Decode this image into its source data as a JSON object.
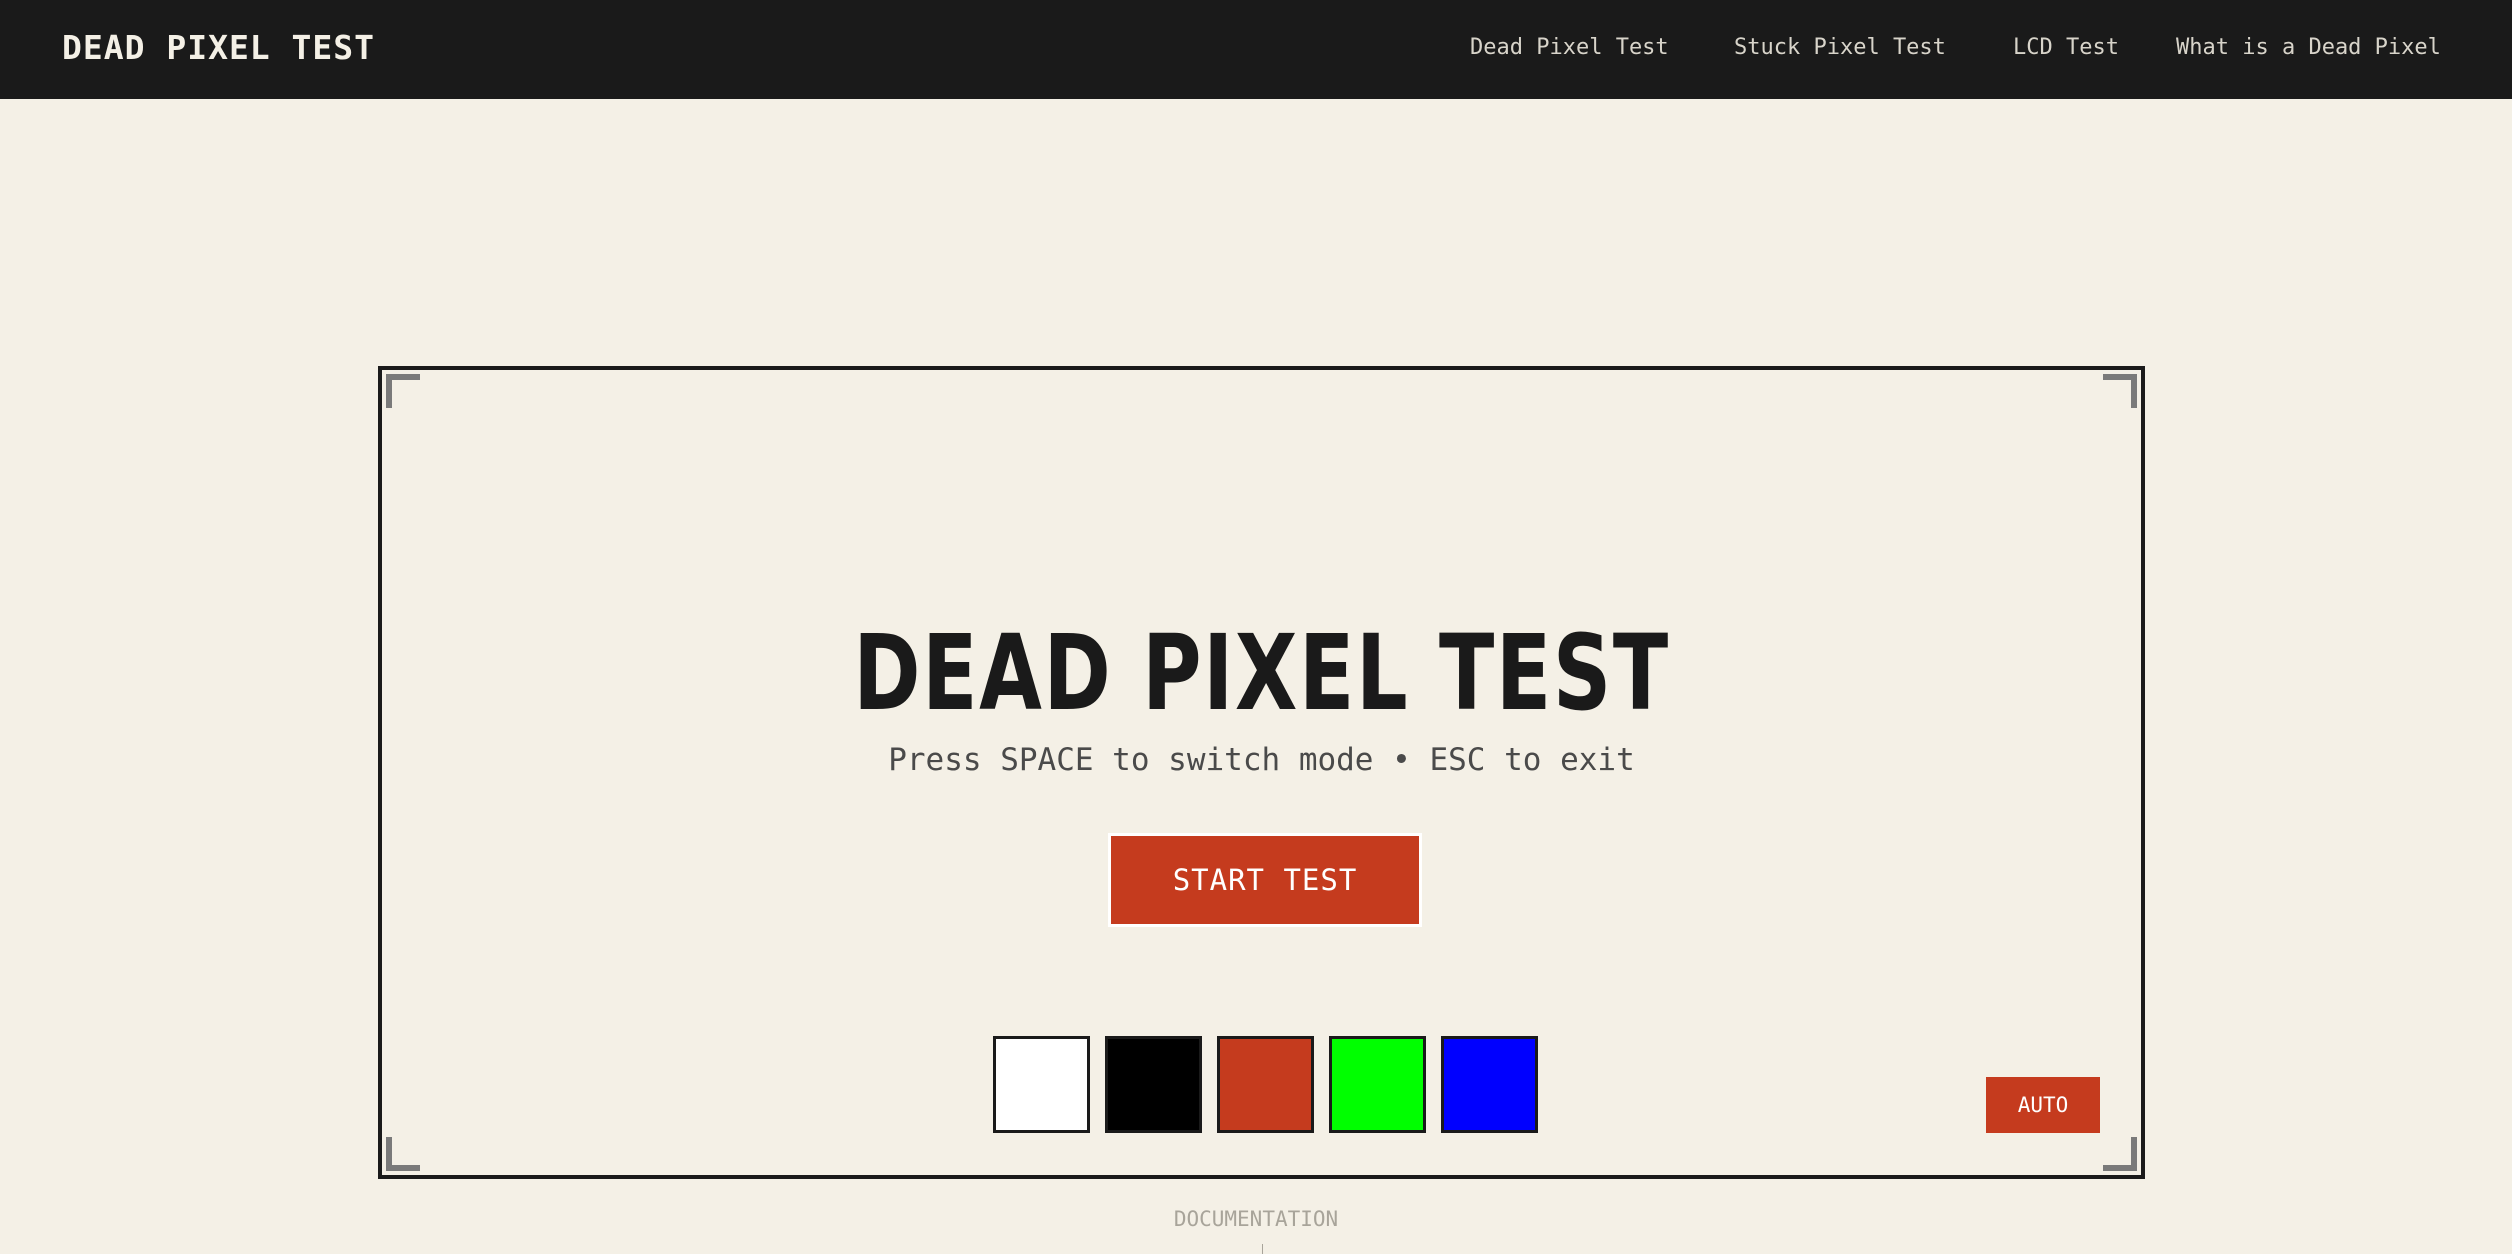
{
  "header": {
    "brand": "DEAD PIXEL TEST",
    "nav": [
      {
        "label": "Dead Pixel Test"
      },
      {
        "label": "Stuck Pixel Test"
      },
      {
        "label": "LCD Test"
      },
      {
        "label": "What is a Dead Pixel"
      }
    ]
  },
  "hero": {
    "title": "DEAD PIXEL TEST",
    "subtitle": "Press SPACE to switch mode • ESC to exit",
    "start_label": "START TEST",
    "auto_label": "AUTO"
  },
  "swatches": [
    {
      "name": "white",
      "color": "#ffffff"
    },
    {
      "name": "black",
      "color": "#000000"
    },
    {
      "name": "red",
      "color": "#c53b1e"
    },
    {
      "name": "green",
      "color": "#00ff00"
    },
    {
      "name": "blue",
      "color": "#0000ff"
    }
  ],
  "footer": {
    "documentation_label": "DOCUMENTATION"
  },
  "colors": {
    "accent": "#c53b1e",
    "nav_bg": "#1a1a1a",
    "page_bg": "#f4f0e6"
  }
}
